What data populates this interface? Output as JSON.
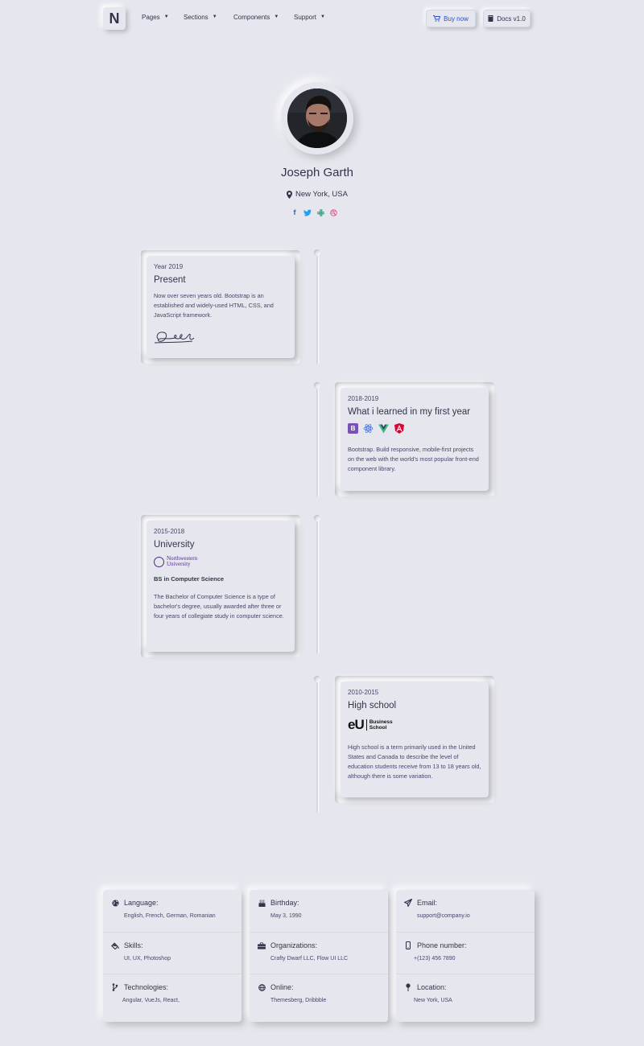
{
  "nav": {
    "brand": "N",
    "menu": [
      {
        "label": "Pages"
      },
      {
        "label": "Sections"
      },
      {
        "label": "Components"
      },
      {
        "label": "Support"
      }
    ],
    "buy_label": "Buy now",
    "docs_label": "Docs v1.0"
  },
  "profile": {
    "name": "Joseph Garth",
    "location": "New York, USA",
    "socials": [
      "facebook-icon",
      "twitter-icon",
      "slack-icon",
      "dribbble-icon"
    ]
  },
  "timeline": [
    {
      "year": "Year 2019",
      "title": "Present",
      "desc": "Now over seven years old. Bootstrap is an established and widely-used HTML, CSS, and JavaScript framework."
    },
    {
      "year": "2018-2019",
      "title": "What i learned in my first year",
      "techs": [
        "B",
        "React",
        "V",
        "A"
      ],
      "desc": "Bootstrap. Build responsive, mobile-first projects on the web with the world's most popular front-end component library."
    },
    {
      "year": "2015-2018",
      "title": "University",
      "logo_line1": "Northwestern",
      "logo_line2": "University",
      "degree": "BS in Computer Science",
      "desc": "The Bachelor of Computer Science is a type of bachelor's degree, usually awarded after three or four years of collegiate study in computer science."
    },
    {
      "year": "2010-2015",
      "title": "High school",
      "logo_mark": "eU",
      "logo_line1": "Business",
      "logo_line2": "School",
      "desc": "High school is a term primarily used in the United States and Canada to describe the level of education students receive from 13 to 18 years old, although there is some variation."
    }
  ],
  "info": [
    [
      {
        "label": "Language:",
        "value": "English, French, German, Romanian",
        "icon": "globe-icon"
      },
      {
        "label": "Skills:",
        "value": "UI, UX, Photoshop",
        "icon": "paint-bucket-icon"
      },
      {
        "label": "Technologies:",
        "value": "Angular, VueJs, React,",
        "icon": "code-branch-icon"
      }
    ],
    [
      {
        "label": "Birthday:",
        "value": "May 3, 1990",
        "icon": "cake-icon"
      },
      {
        "label": "Organizations:",
        "value": "Crafty Dwarf LLC, Flow UI LLC",
        "icon": "briefcase-icon"
      },
      {
        "label": "Online:",
        "value": "Themesberg, Dribbble",
        "icon": "globe-icon"
      }
    ],
    [
      {
        "label": "Email:",
        "value": "support@company.io",
        "icon": "paper-plane-icon"
      },
      {
        "label": "Phone number:",
        "value": "+(123) 456 7890",
        "icon": "mobile-phone-icon"
      },
      {
        "label": "Location:",
        "value": "New York, USA",
        "icon": "map-pin-icon"
      }
    ]
  ],
  "colors": {
    "background": "#e6e7ee",
    "text": "#31344b",
    "accent": "#2d4cc8",
    "facebook": "#3b5999",
    "twitter": "#1da1f2",
    "slack": "#3aaf85",
    "dribbble": "#ea4c89"
  }
}
